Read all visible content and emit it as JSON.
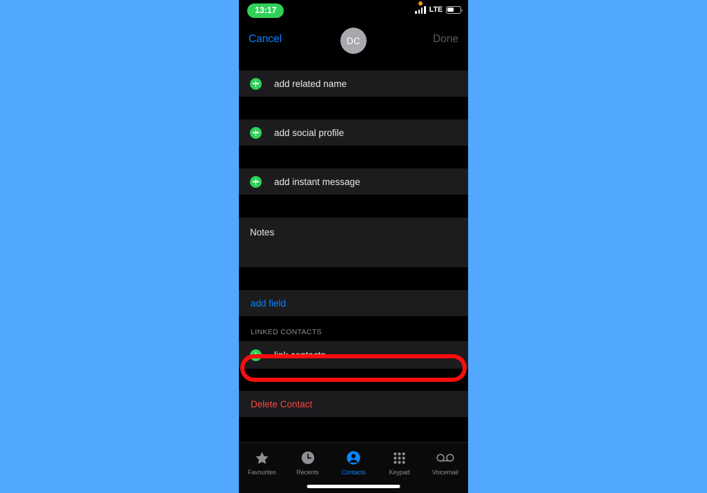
{
  "status_bar": {
    "time": "13:17",
    "time_badge_color": "#30d158",
    "carrier_network": "LTE",
    "recording_dot": "orange-dot-icon",
    "signal_icon": "cellular-signal-icon",
    "battery_icon": "battery-icon"
  },
  "nav_bar": {
    "cancel_label": "Cancel",
    "done_label": "Done",
    "cancel_color": "#0a84ff",
    "done_color": "#5c5c5e",
    "avatar_initials": "DC"
  },
  "form": {
    "rows": [
      {
        "label": "add related name",
        "icon": "plus-circle-icon",
        "style": "default"
      },
      {
        "label": "add social profile",
        "icon": "plus-circle-icon",
        "style": "default"
      },
      {
        "label": "add instant message",
        "icon": "plus-circle-icon",
        "style": "default"
      }
    ],
    "notes_label": "Notes",
    "add_field_label": "add field",
    "delete_contact_label": "Delete Contact",
    "add_field_color": "#0a84ff",
    "delete_color": "#ff453a"
  },
  "linked_contacts": {
    "section_title": "LINKED CONTACTS",
    "link_label": "link contacts...",
    "icon": "plus-circle-icon",
    "highlight_color": "#fb0d0d"
  },
  "tab_bar": {
    "tabs": [
      {
        "label": "Favourites",
        "icon": "star-icon",
        "active": false
      },
      {
        "label": "Recents",
        "icon": "clock-icon",
        "active": false
      },
      {
        "label": "Contacts",
        "icon": "person-circle-icon",
        "active": true
      },
      {
        "label": "Keypad",
        "icon": "keypad-grid-icon",
        "active": false
      },
      {
        "label": "Voicemail",
        "icon": "voicemail-icon",
        "active": false
      }
    ],
    "active_color": "#0a84ff",
    "inactive_color": "#8e8e93"
  },
  "backdrop_color": "#52a8ff"
}
